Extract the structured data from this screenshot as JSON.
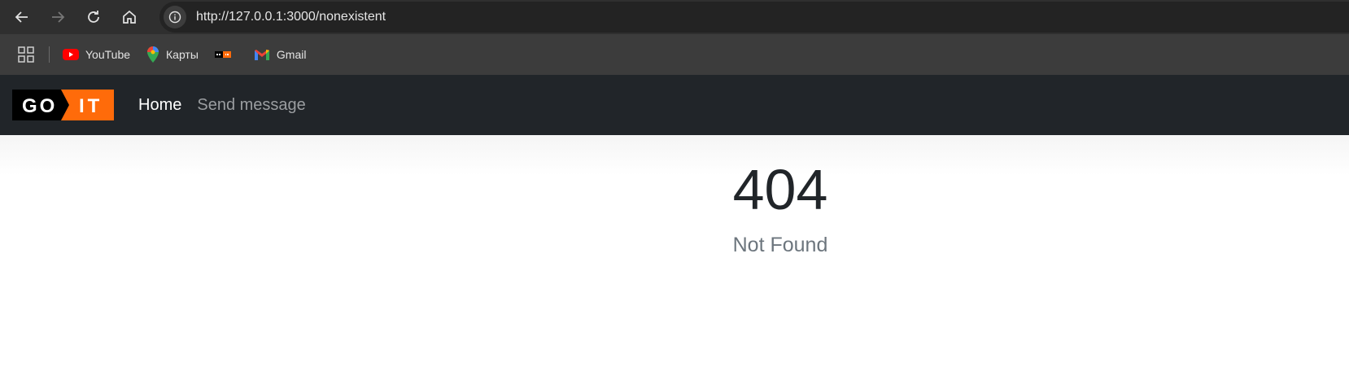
{
  "browser": {
    "url": "http://127.0.0.1:3000/nonexistent",
    "nav_icons": [
      "back-icon",
      "forward-icon",
      "reload-icon",
      "home-icon"
    ],
    "bookmarks": [
      {
        "label": "YouTube",
        "icon": "youtube-icon"
      },
      {
        "label": "Карты",
        "icon": "maps-icon"
      },
      {
        "label": "",
        "icon": "goit-icon"
      },
      {
        "label": "Gmail",
        "icon": "gmail-icon"
      }
    ]
  },
  "navbar": {
    "logo": {
      "left": "GO",
      "right": "IT"
    },
    "links": [
      {
        "label": "Home",
        "active": true
      },
      {
        "label": "Send message",
        "active": false
      }
    ]
  },
  "error": {
    "code": "404",
    "message": "Not Found"
  },
  "colors": {
    "navbar_bg": "#212529",
    "logo_orange": "#ff6b0a",
    "text_dark": "#212529",
    "text_muted": "#6c757d"
  }
}
